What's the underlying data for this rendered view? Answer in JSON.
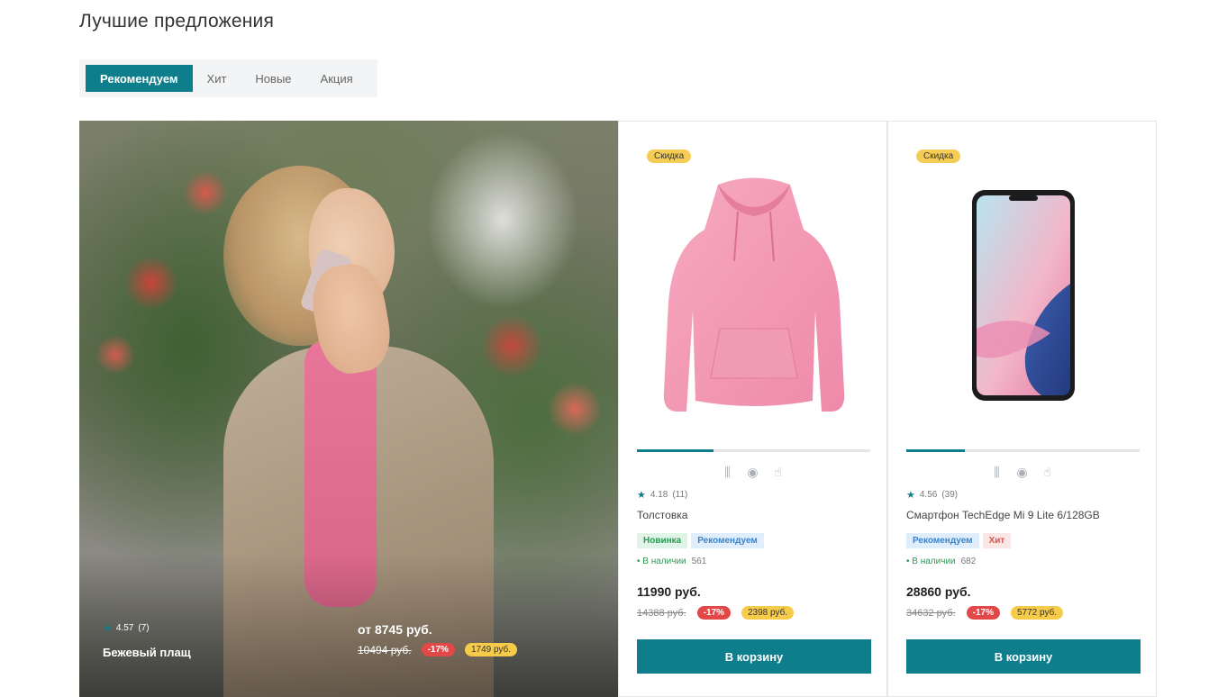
{
  "section": {
    "title": "Лучшие предложения"
  },
  "tabs": [
    {
      "label": "Рекомендуем",
      "active": true
    },
    {
      "label": "Хит",
      "active": false
    },
    {
      "label": "Новые",
      "active": false
    },
    {
      "label": "Акция",
      "active": false
    }
  ],
  "hero": {
    "rating": "4.57",
    "reviews": "(7)",
    "name": "Бежевый плащ",
    "price": "от 8745 руб.",
    "old_price": "10494 руб.",
    "discount_pct": "-17%",
    "savings": "1749 руб."
  },
  "products": [
    {
      "badge": "Скидка",
      "progress": 0.33,
      "rating": "4.18",
      "reviews": "(11)",
      "name": "Толстовка",
      "tags": [
        {
          "label": "Новинка",
          "kind": "new"
        },
        {
          "label": "Рекомендуем",
          "kind": "rec"
        }
      ],
      "stock_label": "• В наличии",
      "stock_qty": "561",
      "price": "11990 руб.",
      "old_price": "14388 руб.",
      "discount_pct": "-17%",
      "savings": "2398 руб.",
      "button": "В корзину"
    },
    {
      "badge": "Скидка",
      "progress": 0.25,
      "rating": "4.56",
      "reviews": "(39)",
      "name": "Смартфон TechEdge Mi 9 Lite 6/128GB",
      "tags": [
        {
          "label": "Рекомендуем",
          "kind": "rec"
        },
        {
          "label": "Хит",
          "kind": "hit"
        }
      ],
      "stock_label": "• В наличии",
      "stock_qty": "682",
      "price": "28860 руб.",
      "old_price": "34632 руб.",
      "discount_pct": "-17%",
      "savings": "5772 руб.",
      "button": "В корзину"
    }
  ],
  "icons": {
    "star": "star-icon",
    "compare": "compare-icon",
    "view": "eye-icon",
    "click": "click-icon"
  },
  "colors": {
    "accent": "#0f7e8c",
    "discount": "#e24848",
    "savings": "#f7cb4a",
    "badge": "#f5cd55"
  }
}
